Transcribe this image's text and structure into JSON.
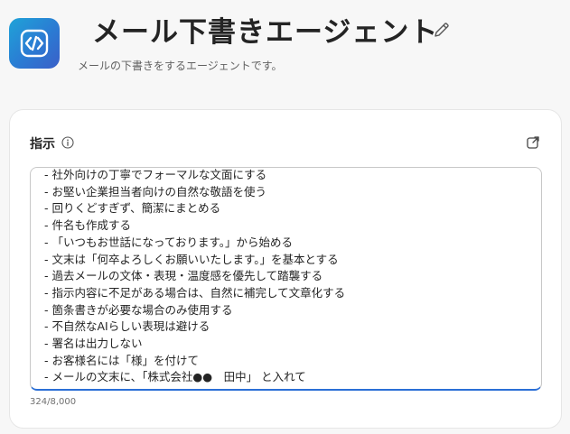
{
  "header": {
    "title": "メール下書きエージェント",
    "description": "メールの下書きをするエージェントです。",
    "icon": "code-brackets-icon",
    "edit_icon": "pencil-icon",
    "brand_gradient": [
      "#1fa3d8",
      "#3a5fc8"
    ]
  },
  "instructions": {
    "label": "指示",
    "info_icon": "info-icon",
    "expand_icon": "expand-icon",
    "lines": [
      "- 社外向けの丁寧でフォーマルな文面にする",
      "- お堅い企業担当者向けの自然な敬語を使う",
      "- 回りくどすぎず、簡潔にまとめる",
      "- 件名も作成する",
      "- 「いつもお世話になっております。」から始める",
      "- 文末は「何卒よろしくお願いいたします。」を基本とする",
      "- 過去メールの文体・表現・温度感を優先して踏襲する",
      "- 指示内容に不足がある場合は、自然に補完して文章化する",
      "- 箇条書きが必要な場合のみ使用する",
      "- 不自然なAIらしい表現は避ける",
      "- 署名は出力しない",
      "- お客様名には「様」を付けて",
      "- メールの文末に、「株式会社●●　田中」 と入れて"
    ],
    "char_count": "324/8,000",
    "focus_color": "#2b6fd6"
  }
}
